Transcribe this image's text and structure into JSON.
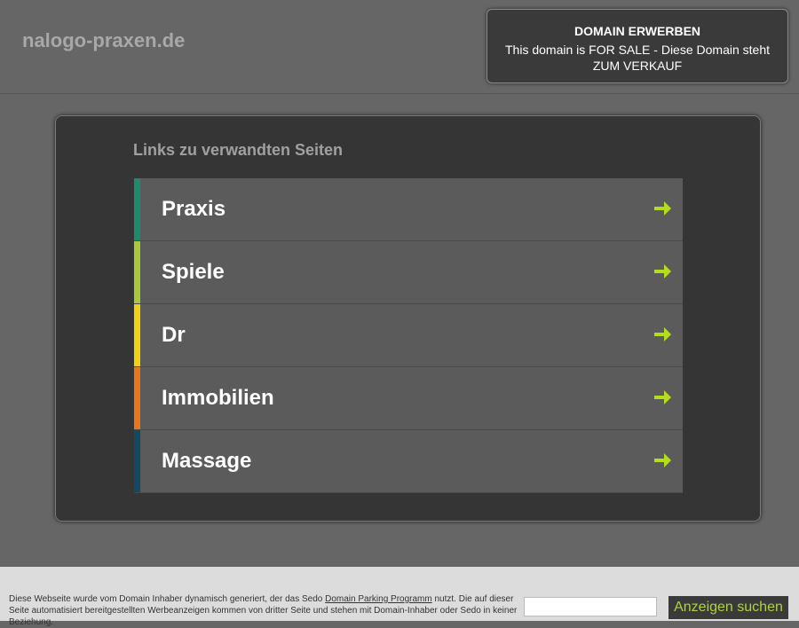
{
  "header": {
    "site_title": "nalogo-praxen.de",
    "sale_title": "DOMAIN ERWERBEN",
    "sale_text": "This domain is FOR SALE - Diese Domain steht ZUM VERKAUF"
  },
  "main": {
    "heading": "Links zu verwandten Seiten",
    "links": [
      {
        "label": "Praxis",
        "color": "#1e8a6e"
      },
      {
        "label": "Spiele",
        "color": "#a8c83a"
      },
      {
        "label": "Dr",
        "color": "#f0d20f"
      },
      {
        "label": "Immobilien",
        "color": "#e8761a"
      },
      {
        "label": "Massage",
        "color": "#114a62"
      }
    ],
    "arrow_color": "#b5de1a",
    "arrow_icon": "arrow-right-icon"
  },
  "footer": {
    "disclaimer_before": "Diese Webseite wurde vom Domain Inhaber dynamisch generiert, der das Sedo ",
    "disclaimer_link": "Domain Parking Programm",
    "disclaimer_after": " nutzt. Die auf dieser Seite automatisiert bereitgestellten Werbeanzeigen kommen von dritter Seite und stehen mit Domain-Inhaber oder Sedo in keiner Beziehung.",
    "search_value": "",
    "search_button_label": "Anzeigen suchen"
  }
}
